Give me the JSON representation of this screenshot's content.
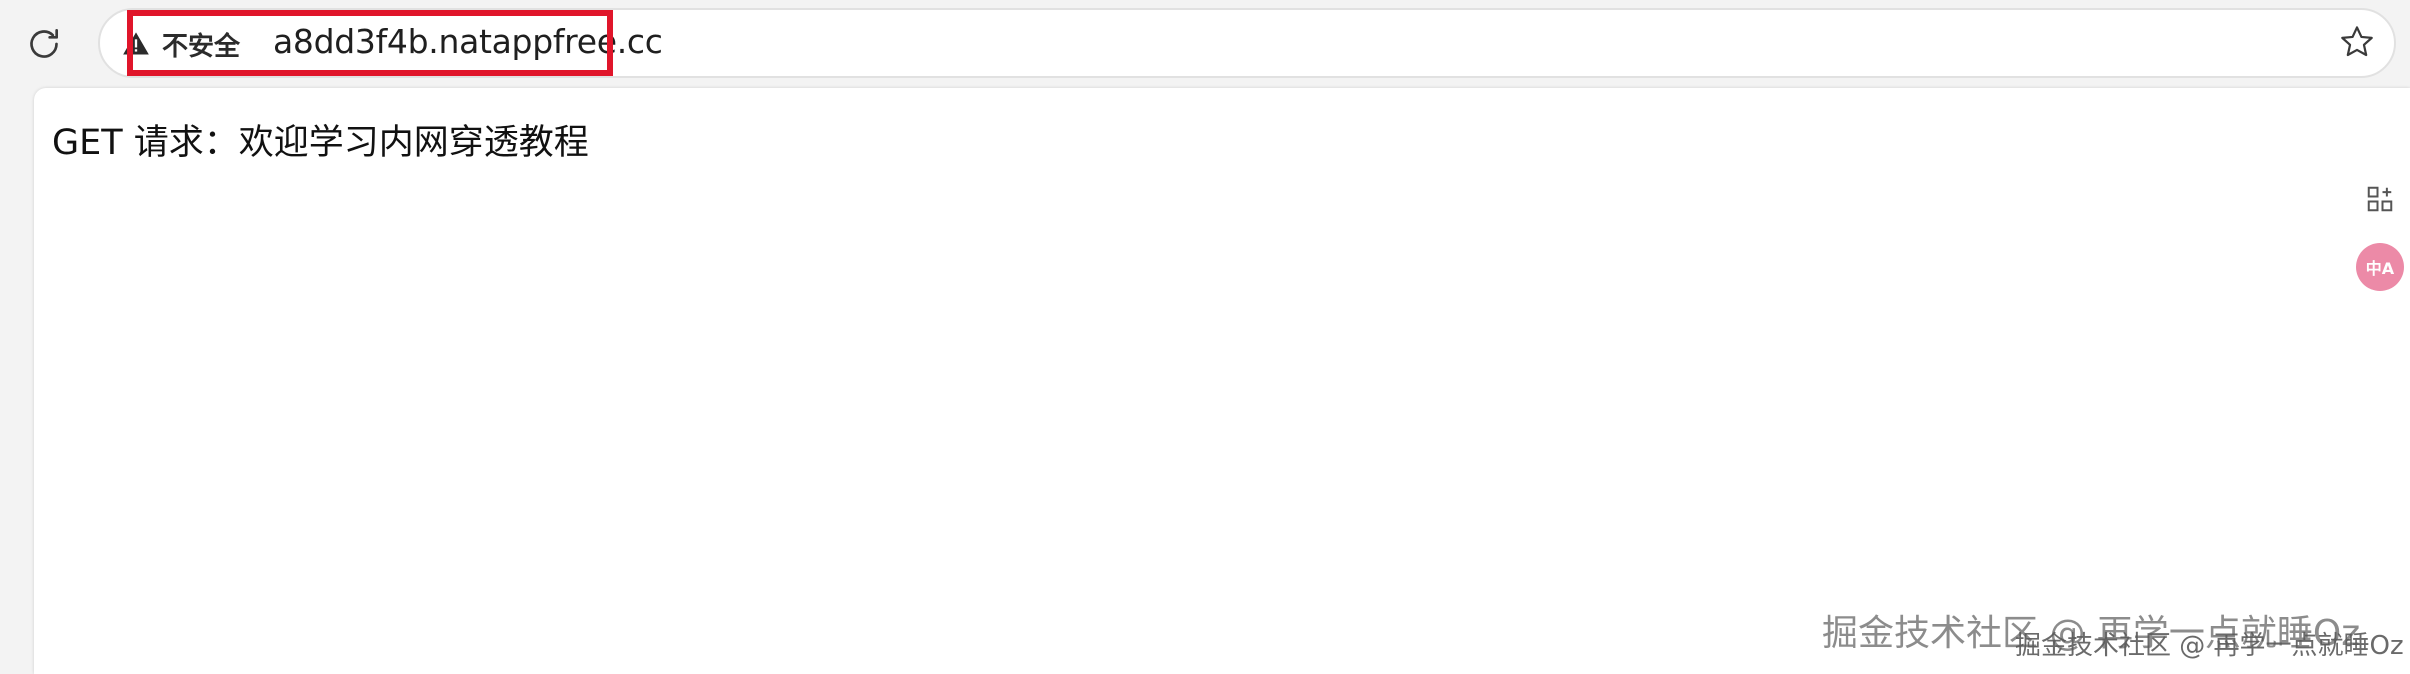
{
  "browser": {
    "security_label": "不安全",
    "url": "a8dd3f4b.natappfree.cc",
    "reload_icon": "reload-icon",
    "warning_icon": "warning-triangle-icon",
    "favorite_icon": "star-icon"
  },
  "page": {
    "text": "GET 请求：欢迎学习内网穿透教程"
  },
  "side_panel": {
    "apps_icon": "add-app-icon",
    "translate_label": "中A"
  },
  "watermark": {
    "large": "掘金技术社区 @ 再学一点就睡Oz",
    "small": "掘金技术社区 @ 再学一点就睡Oz"
  },
  "colors": {
    "highlight": "#e0152a",
    "translate_bg": "#ec8aa7",
    "toolbar_bg": "#f3f3f3"
  }
}
